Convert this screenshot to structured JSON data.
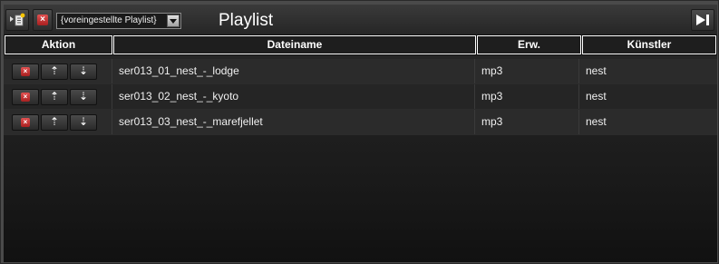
{
  "window": {
    "title": "Playlist"
  },
  "toolbar": {
    "new_playlist_icon": "new-playlist-icon",
    "clear_icon": "delete-x-icon",
    "playlist_select": {
      "selected": "{voreingestellte Playlist}"
    },
    "next_icon": "skip-next-icon"
  },
  "table": {
    "columns": [
      "Aktion",
      "Dateiname",
      "Erw.",
      "Künstler"
    ],
    "rows": [
      {
        "filename": "ser013_01_nest_-_lodge",
        "ext": "mp3",
        "artist": "nest"
      },
      {
        "filename": "ser013_02_nest_-_kyoto",
        "ext": "mp3",
        "artist": "nest"
      },
      {
        "filename": "ser013_03_nest_-_marefjellet",
        "ext": "mp3",
        "artist": "nest"
      }
    ],
    "action_glyphs": {
      "remove": "×",
      "up": "⇡",
      "down": "⇣"
    }
  },
  "colors": {
    "remove_red": "#c83030",
    "header_border": "#ffffff",
    "background": "#1b1b1b"
  }
}
